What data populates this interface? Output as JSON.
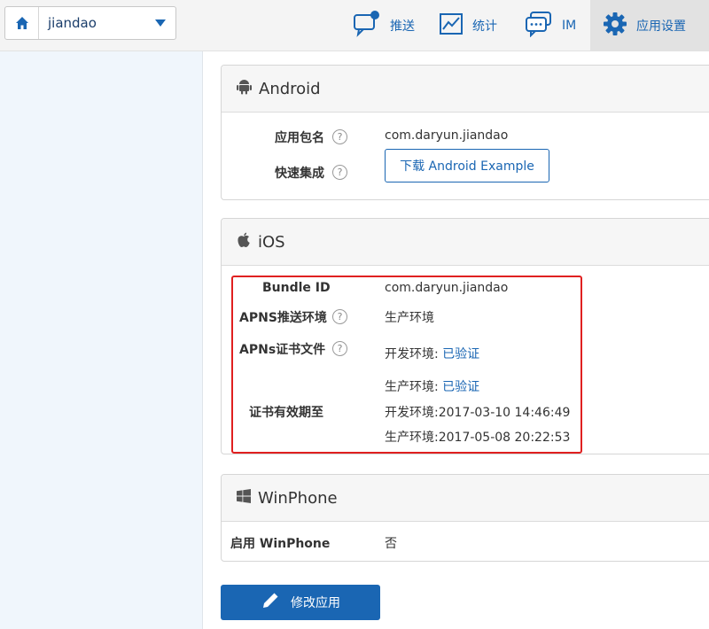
{
  "header": {
    "app_name": "jiandao",
    "nav": {
      "push": "推送",
      "stats": "统计",
      "im": "IM",
      "settings": "应用设置"
    }
  },
  "android": {
    "title": "Android",
    "package_label": "应用包名",
    "package_value": "com.daryun.jiandao",
    "quick_label": "快速集成",
    "download_button": "下载 Android Example"
  },
  "ios": {
    "title": "iOS",
    "bundle_label": "Bundle ID",
    "bundle_value": "com.daryun.jiandao",
    "apns_env_label": "APNS推送环境",
    "apns_env_value": "生产环境",
    "cert_label": "APNs证书文件",
    "cert_dev_prefix": "开发环境: ",
    "cert_dev_status": "已验证",
    "cert_prod_prefix": "生产环境: ",
    "cert_prod_status": "已验证",
    "expiry_label": "证书有效期至",
    "expiry_dev": "开发环境:2017-03-10 14:46:49",
    "expiry_prod": "生产环境:2017-05-08 20:22:53"
  },
  "winphone": {
    "title": "WinPhone",
    "enable_label": "启用 WinPhone",
    "enable_value": "否"
  },
  "footer": {
    "edit_button": "修改应用"
  },
  "help_glyph": "?",
  "colors": {
    "accent": "#1a66b3",
    "highlight": "#e02020",
    "sidebar": "#f0f6fc"
  }
}
